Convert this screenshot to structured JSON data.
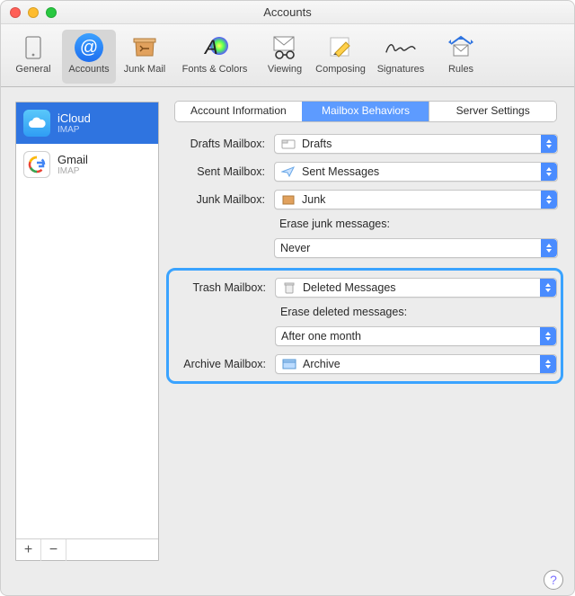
{
  "title": "Accounts",
  "toolbar": [
    {
      "id": "general",
      "label": "General"
    },
    {
      "id": "accounts",
      "label": "Accounts"
    },
    {
      "id": "junk",
      "label": "Junk Mail"
    },
    {
      "id": "fonts",
      "label": "Fonts & Colors"
    },
    {
      "id": "viewing",
      "label": "Viewing"
    },
    {
      "id": "composing",
      "label": "Composing"
    },
    {
      "id": "signatures",
      "label": "Signatures"
    },
    {
      "id": "rules",
      "label": "Rules"
    }
  ],
  "accounts": [
    {
      "name": "iCloud",
      "proto": "IMAP"
    },
    {
      "name": "Gmail",
      "proto": "IMAP"
    }
  ],
  "tabs": {
    "info": "Account Information",
    "behaviors": "Mailbox Behaviors",
    "server": "Server Settings"
  },
  "labels": {
    "drafts": "Drafts Mailbox:",
    "sent": "Sent Mailbox:",
    "junk": "Junk Mailbox:",
    "erase_junk": "Erase junk messages:",
    "trash": "Trash Mailbox:",
    "erase_deleted": "Erase deleted messages:",
    "archive": "Archive Mailbox:"
  },
  "values": {
    "drafts": "Drafts",
    "sent": "Sent Messages",
    "junk": "Junk",
    "erase_junk": "Never",
    "trash": "Deleted Messages",
    "erase_deleted": "After one month",
    "archive": "Archive"
  },
  "buttons": {
    "add": "+",
    "remove": "−",
    "help": "?"
  }
}
